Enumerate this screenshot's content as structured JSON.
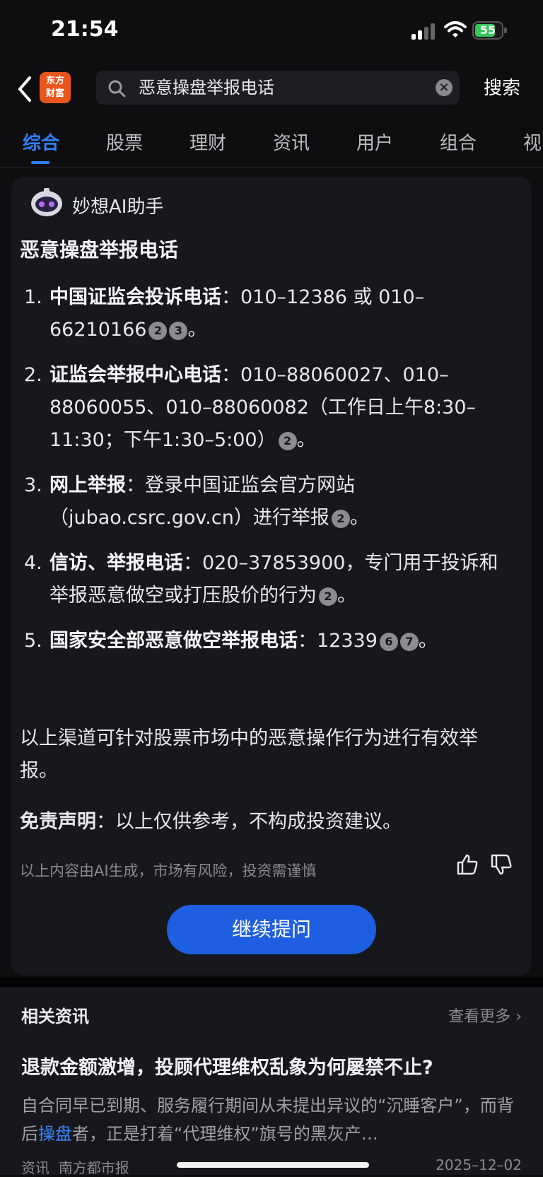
{
  "status": {
    "time": "21:54",
    "battery": "55"
  },
  "header": {
    "logo_line1": "东方",
    "logo_line2": "财富",
    "search_query": "恶意操盘举报电话",
    "search_action": "搜索"
  },
  "tabs": [
    "综合",
    "股票",
    "理财",
    "资讯",
    "用户",
    "组合",
    "视"
  ],
  "answer": {
    "assistant_name": "妙想AI助手",
    "title": "恶意操盘举报电话",
    "items": [
      {
        "num": "1.",
        "bold": "中国证监会投诉电话",
        "text": "：010–12386 或 010–66210166",
        "cites": [
          "2",
          "3"
        ],
        "tail": "。"
      },
      {
        "num": "2.",
        "bold": "证监会举报中心电话",
        "text": "：010–88060027、010–88060055、010–88060082（工作日上午8:30–11:30；下午1:30–5:00）",
        "cites": [
          "2"
        ],
        "tail": "。"
      },
      {
        "num": "3.",
        "bold": "网上举报",
        "text": "：登录中国证监会官方网站（jubao.csrc.gov.cn）进行举报",
        "cites": [
          "2"
        ],
        "tail": "。"
      },
      {
        "num": "4.",
        "bold": "信访、举报电话",
        "text": "：020–37853900，专门用于投诉和举报恶意做空或打压股价的行为",
        "cites": [
          "2"
        ],
        "tail": "。"
      },
      {
        "num": "5.",
        "bold": "国家安全部恶意做空举报电话",
        "text": "：12339",
        "cites": [
          "6",
          "7"
        ],
        "tail": "。"
      }
    ],
    "summary": "以上渠道可针对股票市场中的恶意操作行为进行有效举报。",
    "disclaimer_bold": "免责声明",
    "disclaimer_text": "：以上仅供参考，不构成投资建议。",
    "ai_note": "以上内容由AI生成，市场有风险，投资需谨慎",
    "continue_label": "继续提问"
  },
  "news": {
    "heading": "相关资讯",
    "more": "查看更多",
    "title": "退款金额激增，投顾代理维权乱象为何屡禁不止?",
    "snippet_before": "自合同早已到期、服务履行期间从未提出异议的“沉睡客户”，而背后",
    "snippet_keyword": "操盘",
    "snippet_after": "者，正是打着“代理维权”旗号的黑灰产…",
    "source_type": "资讯",
    "source": "南方都市报",
    "date": "2025–12–02"
  },
  "colors": {
    "accent": "#2f7ef6",
    "button": "#1d5fe0",
    "background": "#0e0e10",
    "card": "#17181c"
  }
}
